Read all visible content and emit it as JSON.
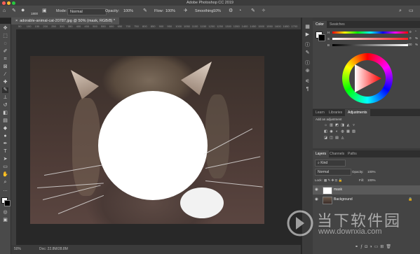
{
  "app": {
    "title": "Adobe Photoshop CC 2019"
  },
  "options_bar": {
    "brush_size": "1800",
    "mode_label": "Mode:",
    "mode_value": "Normal",
    "opacity_label": "Opacity:",
    "opacity_value": "100%",
    "flow_label": "Flow:",
    "flow_value": "100%",
    "smoothing_label": "Smoothing:",
    "smoothing_value": "10%"
  },
  "document": {
    "tab_title": "adorable-animal-cat-20787.jpg @ 50% (mask, RGB/8) *",
    "ruler_marks": [
      "50",
      "100",
      "150",
      "200",
      "250",
      "300",
      "350",
      "400",
      "450",
      "500",
      "550",
      "600",
      "650",
      "700",
      "750",
      "800",
      "850",
      "900",
      "950",
      "1000",
      "1050",
      "1100",
      "1150",
      "1200",
      "1250",
      "1300",
      "1350",
      "1400",
      "1450",
      "1500",
      "1550",
      "1600",
      "1650",
      "1700"
    ]
  },
  "status": {
    "zoom": "50%",
    "doc_info": "Doc: 22.8M/28.8M"
  },
  "color_panel": {
    "tabs": [
      "Color",
      "Swatches"
    ],
    "channels": [
      {
        "label": "H",
        "value": "0",
        "unit": "°"
      },
      {
        "label": "S",
        "value": "0",
        "unit": "%"
      },
      {
        "label": "B",
        "value": "100",
        "unit": "%"
      }
    ]
  },
  "adjustments_panel": {
    "tabs": [
      "Learn",
      "Libraries",
      "Adjustments"
    ],
    "add_label": "Add an adjustment",
    "row1": [
      "☼",
      "▥",
      "◩",
      "◨",
      "◭",
      "▿"
    ],
    "row2": [
      "◧",
      "◉",
      "◐",
      "◍",
      "▦",
      "▧"
    ],
    "row3": [
      "◪",
      "◫",
      "▤",
      "◬"
    ]
  },
  "layers_panel": {
    "tabs": [
      "Layers",
      "Channels",
      "Paths"
    ],
    "filter_label": "Kind",
    "blend_mode": "Normal",
    "opacity_label": "Opacity:",
    "opacity_value": "100%",
    "lock_label": "Lock:",
    "fill_label": "Fill:",
    "fill_value": "100%",
    "layers": [
      {
        "name": "mask",
        "selected": true
      },
      {
        "name": "Background",
        "selected": false
      }
    ]
  },
  "watermark": {
    "brand_cn": "当下软件园",
    "url": "www.downxia.com"
  },
  "colors": {
    "accent": "#5b8ce0",
    "titlebar": "#3c3c3c",
    "panel": "#444444"
  }
}
